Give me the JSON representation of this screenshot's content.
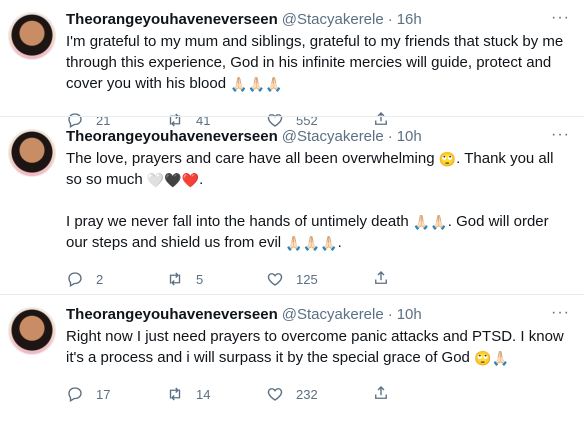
{
  "tweets": [
    {
      "name": "Theorangeyouhaveneverseen",
      "handle": "@Stacyakerele",
      "time": "16h",
      "text": "I'm grateful to my mum and siblings, grateful to my friends that stuck by me through this experience, God in his infinite mercies will guide, protect and cover you with his blood ",
      "emojis": "🙏🏻🙏🏻🙏🏻",
      "replies": "21",
      "retweets": "41",
      "likes": "552"
    },
    {
      "name": "Theorangeyouhaveneverseen",
      "handle": "@Stacyakerele",
      "time": "10h",
      "p1a": "The love, prayers and care have all been overwhelming ",
      "p1e1": "🙄",
      "p1b": ". Thank you all so so much ",
      "p1e2": "🤍🖤❤️",
      "p1c": ".",
      "p2a": "I pray we never fall into the hands of untimely death ",
      "p2e1": "🙏🏻🙏🏻",
      "p2b": ". God will order our steps and shield us from evil ",
      "p2e2": "🙏🏻🙏🏻🙏🏻",
      "p2c": ".",
      "replies": "2",
      "retweets": "5",
      "likes": "125"
    },
    {
      "name": "Theorangeyouhaveneverseen",
      "handle": "@Stacyakerele",
      "time": "10h",
      "text": "Right now I just need prayers to overcome panic attacks and PTSD. I know it's a process and i will surpass it by the special grace of God ",
      "emojis": "🙄🙏🏻",
      "replies": "17",
      "retweets": "14",
      "likes": "232"
    }
  ],
  "icons": {
    "reply": "reply-icon",
    "retweet": "retweet-icon",
    "like": "heart-icon",
    "share": "share-icon",
    "more": "more-icon"
  },
  "colors": {
    "text": "#0f1419",
    "secondary": "#5b7083",
    "border": "#e6ecf0"
  }
}
